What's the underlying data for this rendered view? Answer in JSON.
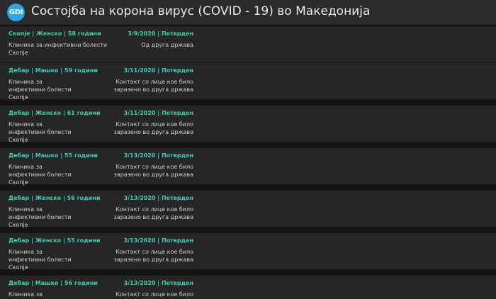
{
  "header": {
    "logo_text": "GDI",
    "title": "Состојба на корона вирус (COVID - 19) во Македонија"
  },
  "colors": {
    "accent": "#3dcfb3",
    "logo": "#2fa6df",
    "header_bg": "#2b2b2b",
    "card_bg": "#262626",
    "page_bg": "#141414"
  },
  "cases": [
    {
      "person": "Скопје | Женско | 58 години",
      "date_status": "3/9/2020 | Потврден",
      "clinic": "Клиника за инфективни болести Скопје",
      "source": "Од друга држава"
    },
    {
      "person": "Дебар | Машко | 59 години",
      "date_status": "3/11/2020 | Потврден",
      "clinic": "Клиника за инфективни болести Скопје",
      "source": "Контакт со лице кое било заразено во друга држава"
    },
    {
      "person": "Дебар | Женско | 61 години",
      "date_status": "3/11/2020 | Потврден",
      "clinic": "Клиника за инфективни болести Скопје",
      "source": "Контакт со лице кое било заразено во друга држава"
    },
    {
      "person": "Дебар | Машко | 55 години",
      "date_status": "3/13/2020 | Потврден",
      "clinic": "Клиника за инфективни болести Скопје",
      "source": "Контакт со лице кое било заразено во друга држава"
    },
    {
      "person": "Дебар | Женско | 56 години",
      "date_status": "3/13/2020 | Потврден",
      "clinic": "Клиника за инфективни болести Скопје",
      "source": "Контакт со лице кое било заразено во друга држава"
    },
    {
      "person": "Дебар | Женско | 55 години",
      "date_status": "3/13/2020 | Потврден",
      "clinic": "Клиника за инфективни болести Скопје",
      "source": "Контакт со лице кое било заразено во друга држава"
    },
    {
      "person": "Дебар | Машко | 56 години",
      "date_status": "3/13/2020 | Потврден",
      "clinic": "Клиника за инфективни болести Скопје",
      "source": "Контакт со лице кое било заразено во друга држава"
    }
  ]
}
